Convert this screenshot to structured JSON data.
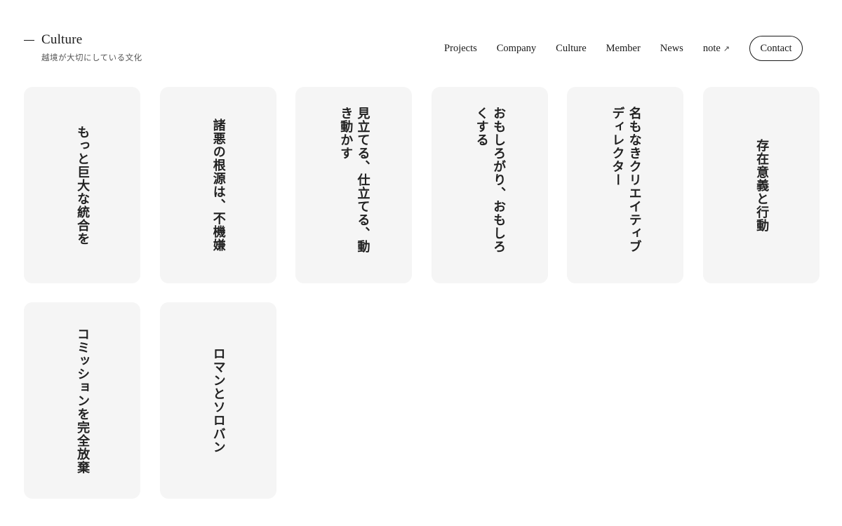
{
  "header": {
    "brand_title": "Culture",
    "brand_subtitle": "越境が大切にしている文化"
  },
  "nav": {
    "items": [
      {
        "label": "Projects"
      },
      {
        "label": "Company"
      },
      {
        "label": "Culture"
      },
      {
        "label": "Member"
      },
      {
        "label": "News"
      },
      {
        "label": "note",
        "icon": "external-link-icon",
        "icon_glyph": "↗"
      }
    ],
    "contact_label": "Contact"
  },
  "cards": [
    {
      "text": "もっと巨大な統合を"
    },
    {
      "text": "諸悪の根源は、不機嫌"
    },
    {
      "text": "見立てる、仕立てる、動き動かす"
    },
    {
      "text": "おもしろがり、おもしろくする"
    },
    {
      "text": "名もなきクリエイティブディレクター"
    },
    {
      "text": "存在意義と行動"
    },
    {
      "text": "コミッションを完全放棄"
    },
    {
      "text": "ロマンとソロバン"
    }
  ],
  "colors": {
    "card_background": "#f5f5f5",
    "text": "#1a1a1a"
  }
}
